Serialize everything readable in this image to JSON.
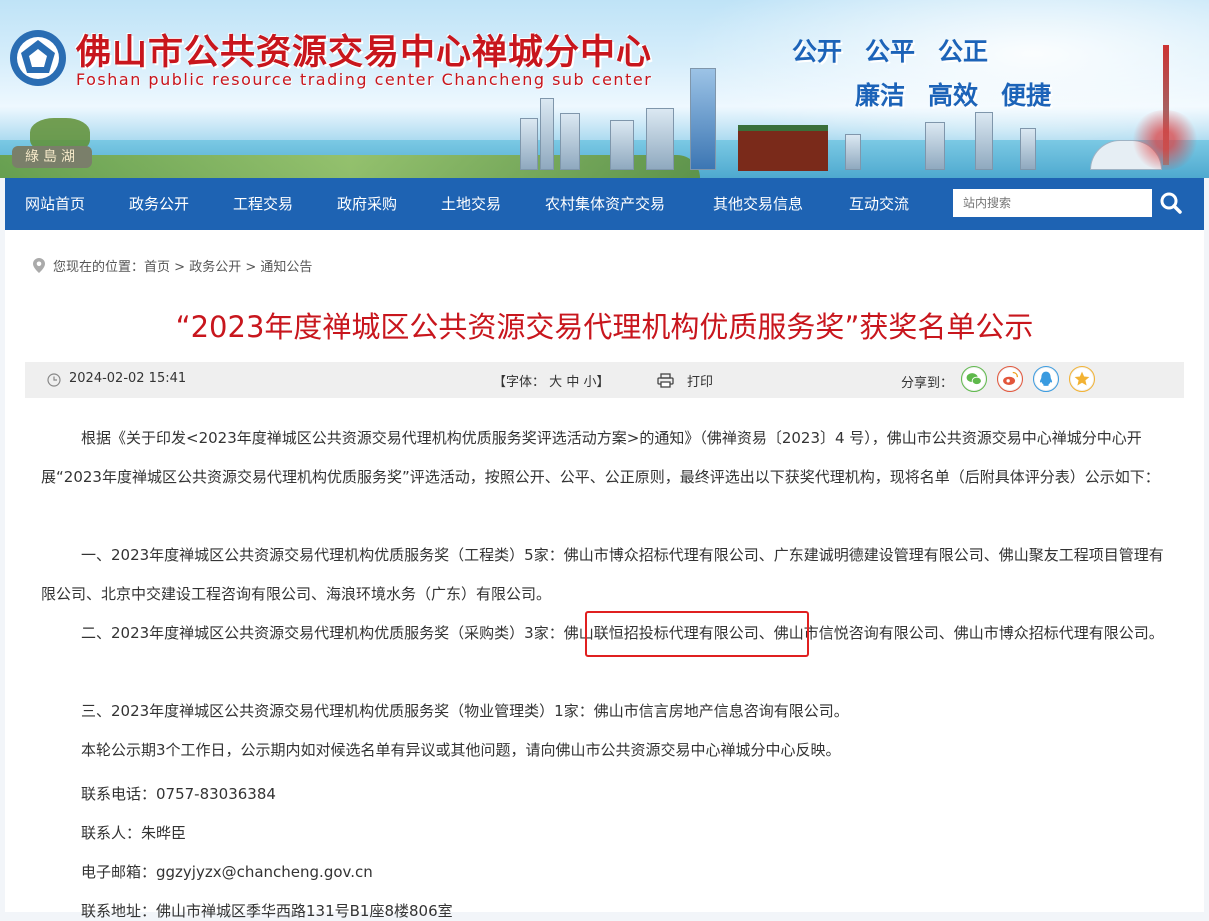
{
  "header": {
    "title_cn": "佛山市公共资源交易中心禅城分中心",
    "title_en": "Foshan public resource trading center Chancheng sub center",
    "slogan_line1": [
      "公开",
      "公平",
      "公正"
    ],
    "slogan_line2": [
      "廉洁",
      "高效",
      "便捷"
    ],
    "lake_sign": "綠島湖",
    "colors": {
      "title_red": "#c8161d",
      "nav_blue": "#1e63b3",
      "slogan_blue": "#1c63b8"
    }
  },
  "nav": {
    "items": [
      "网站首页",
      "政务公开",
      "工程交易",
      "政府采购",
      "土地交易",
      "农村集体资产交易",
      "其他交易信息",
      "互动交流"
    ],
    "search_placeholder": "站内搜索",
    "search_icon": "search-icon"
  },
  "breadcrumb": {
    "prefix": "您现在的位置：",
    "items": [
      "首页",
      "政务公开",
      "通知公告"
    ],
    "separator": " > "
  },
  "article": {
    "title": "“2023年度禅城区公共资源交易代理机构优质服务奖”获奖名单公示",
    "date": "2024-02-02 15:41",
    "font_label": "【字体：",
    "font_sizes": [
      "大",
      "中",
      "小"
    ],
    "font_close": "】",
    "print_label": "打印",
    "share_label": "分享到：",
    "share_icons": [
      "wechat-icon",
      "weibo-icon",
      "qq-icon",
      "qzone-icon"
    ],
    "paragraphs": [
      "根据《关于印发<2023年度禅城区公共资源交易代理机构优质服务奖评选活动方案>的通知》（佛禅资易〔2023〕4 号），佛山市公共资源交易中心禅城分中心开展“2023年度禅城区公共资源交易代理机构优质服务奖”评选活动，按照公开、公平、公正原则，最终评选出以下获奖代理机构，现将名单（后附具体评分表）公示如下：",
      "一、2023年度禅城区公共资源交易代理机构优质服务奖（工程类）5家：佛山市博众招标代理有限公司、广东建诚明德建设管理有限公司、佛山聚友工程项目管理有限公司、北京中交建设工程咨询有限公司、海浪环境水务（广东）有限公司。",
      "二、2023年度禅城区公共资源交易代理机构优质服务奖（采购类）3家：佛山联恒招投标代理有限公司、佛山市信悦咨询有限公司、佛山市博众招标代理有限公司。",
      "三、2023年度禅城区公共资源交易代理机构优质服务奖（物业管理类）1家：佛山市信言房地产信息咨询有限公司。",
      "本轮公示期3个工作日，公示期内如对候选名单有异议或其他问题，请向佛山市公共资源交易中心禅城分中心反映。"
    ],
    "contact_phone": "联系电话：0757-83036384",
    "contact_person": "联系人：朱晔臣",
    "contact_email": "电子邮箱：ggzyjyzx@chancheng.gov.cn",
    "contact_address": "联系地址：佛山市禅城区季华西路131号B1座8楼806室",
    "highlight_color": "#e02020"
  }
}
